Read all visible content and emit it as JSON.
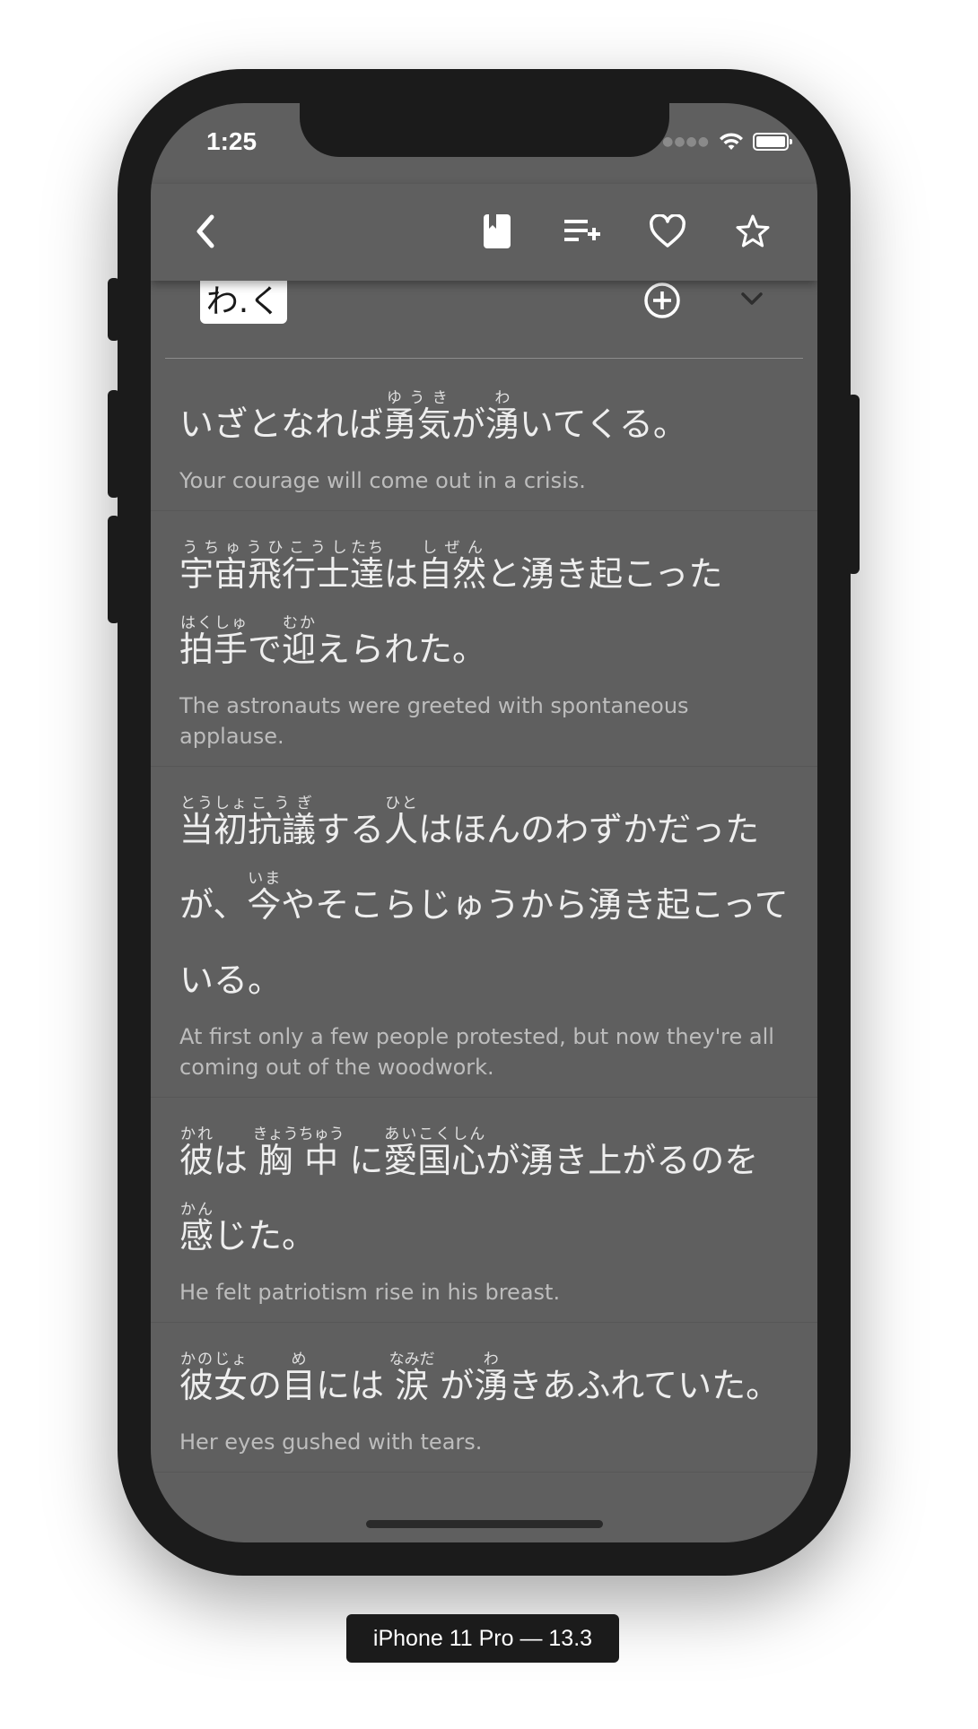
{
  "status_bar": {
    "time": "1:25"
  },
  "toolbar": {
    "back_icon": "chevron-left-icon",
    "actions": [
      "book-icon",
      "playlist-add-icon",
      "heart-icon",
      "star-icon"
    ]
  },
  "entry": {
    "reading": "わ.く"
  },
  "sentences": [
    {
      "segments": [
        {
          "text": "いざとなれば"
        },
        {
          "text": "勇気",
          "ruby": "ゆうき"
        },
        {
          "text": "が"
        },
        {
          "text": "湧",
          "ruby": "わ"
        },
        {
          "text": "いてくる。"
        }
      ],
      "translation": "Your courage will come out in a crisis."
    },
    {
      "segments": [
        {
          "text": "宇宙飛行士",
          "ruby": "うちゅうひこうし"
        },
        {
          "text": "達",
          "ruby": "たち"
        },
        {
          "text": "は"
        },
        {
          "text": "自然",
          "ruby": "しぜん"
        },
        {
          "text": "と湧き起こった"
        },
        {
          "text": "拍手",
          "ruby": "はくしゅ"
        },
        {
          "text": "で"
        },
        {
          "text": "迎",
          "ruby": "むか"
        },
        {
          "text": "えられた。"
        }
      ],
      "translation": "The astronauts were greeted with spontaneous applause."
    },
    {
      "segments": [
        {
          "text": "当初",
          "ruby": "とうしょ"
        },
        {
          "text": "抗議",
          "ruby": "こうぎ"
        },
        {
          "text": "する"
        },
        {
          "text": "人",
          "ruby": "ひと"
        },
        {
          "text": "はほんのわずかだったが、"
        },
        {
          "text": "今",
          "ruby": "いま"
        },
        {
          "text": "や"
        },
        {
          "text": "そこらじゅうから湧き起こっている。"
        }
      ],
      "translation": "At first only a few people protested, but now they're all coming out of the woodwork."
    },
    {
      "segments": [
        {
          "text": "彼",
          "ruby": "かれ"
        },
        {
          "text": "は "
        },
        {
          "text": "胸中",
          "ruby": "きょうちゅう"
        },
        {
          "text": " に"
        },
        {
          "text": "愛国心",
          "ruby": "あいこくしん"
        },
        {
          "text": "が湧き上がるのを"
        },
        {
          "text": "感",
          "ruby": "かん"
        },
        {
          "text": "じた。"
        }
      ],
      "translation": "He felt patriotism rise in his breast."
    },
    {
      "segments": [
        {
          "text": "彼女",
          "ruby": "かのじょ"
        },
        {
          "text": "の"
        },
        {
          "text": "目",
          "ruby": "め"
        },
        {
          "text": "には "
        },
        {
          "text": "涙",
          "ruby": "なみだ"
        },
        {
          "text": " が"
        },
        {
          "text": "湧",
          "ruby": "わ"
        },
        {
          "text": "き"
        },
        {
          "text": "あふれていた。"
        }
      ],
      "translation": "Her eyes gushed with tears."
    }
  ],
  "device_label": "iPhone 11 Pro — 13.3"
}
